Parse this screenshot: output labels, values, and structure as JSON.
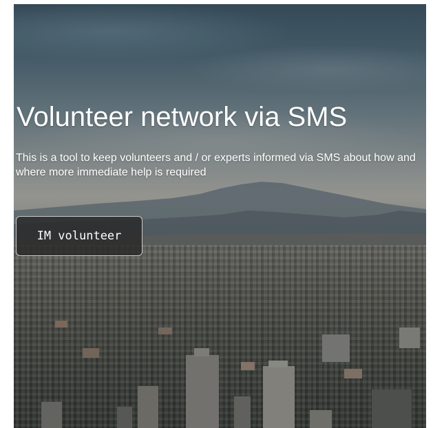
{
  "hero": {
    "title": "Volunteer network via SMS",
    "description": "This is a tool to keep volunteers and / or experts informed via SMS about how and where more immediate help is required",
    "cta_label": "IM volunteer"
  },
  "colors": {
    "text": "#ffffff",
    "button_bg": "#282828",
    "button_border": "#ffffff"
  }
}
